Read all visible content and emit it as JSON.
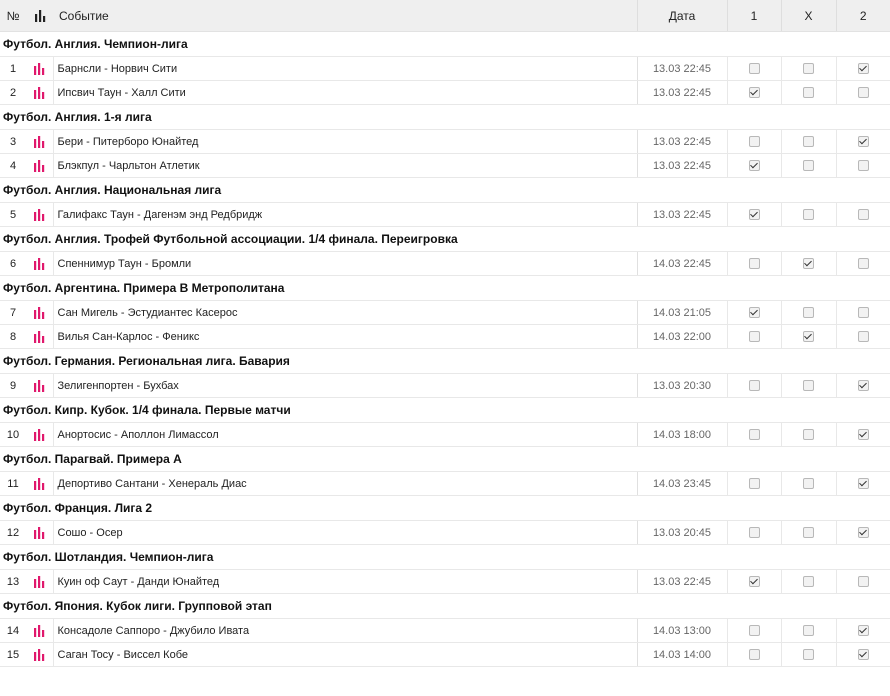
{
  "header": {
    "num": "№",
    "event": "Событие",
    "date": "Дата",
    "o1": "1",
    "ox": "X",
    "o2": "2"
  },
  "colors": {
    "accent": "#e0186c",
    "icon_dark": "#222222"
  },
  "icons": {
    "header": "bar-chart-icon",
    "row": "bar-chart-icon"
  },
  "groups": [
    {
      "title": "Футбол. Англия. Чемпион-лига",
      "events": [
        {
          "n": "1",
          "name": "Барнсли - Норвич Сити",
          "date": "13.03 22:45",
          "sel": [
            false,
            false,
            true
          ]
        },
        {
          "n": "2",
          "name": "Ипсвич Таун - Халл Сити",
          "date": "13.03 22:45",
          "sel": [
            true,
            false,
            false
          ]
        }
      ]
    },
    {
      "title": "Футбол. Англия. 1-я лига",
      "events": [
        {
          "n": "3",
          "name": "Бери - Питерборо Юнайтед",
          "date": "13.03 22:45",
          "sel": [
            false,
            false,
            true
          ]
        },
        {
          "n": "4",
          "name": "Блэкпул - Чарльтон Атлетик",
          "date": "13.03 22:45",
          "sel": [
            true,
            false,
            false
          ]
        }
      ]
    },
    {
      "title": "Футбол. Англия. Национальная лига",
      "events": [
        {
          "n": "5",
          "name": "Галифакс Таун - Дагенэм энд Редбридж",
          "date": "13.03 22:45",
          "sel": [
            true,
            false,
            false
          ]
        }
      ]
    },
    {
      "title": "Футбол. Англия. Трофей Футбольной ассоциации. 1/4 финала. Переигровка",
      "events": [
        {
          "n": "6",
          "name": "Спеннимур Таун - Бромли",
          "date": "14.03 22:45",
          "sel": [
            false,
            true,
            false
          ]
        }
      ]
    },
    {
      "title": "Футбол. Аргентина. Примера B Метрополитана",
      "events": [
        {
          "n": "7",
          "name": "Сан Мигель - Эстудиантес Касерос",
          "date": "14.03 21:05",
          "sel": [
            true,
            false,
            false
          ]
        },
        {
          "n": "8",
          "name": "Вилья Сан-Карлос - Феникс",
          "date": "14.03 22:00",
          "sel": [
            false,
            true,
            false
          ]
        }
      ]
    },
    {
      "title": "Футбол. Германия. Региональная лига. Бавария",
      "events": [
        {
          "n": "9",
          "name": "Зелигенпортен - Бухбах",
          "date": "13.03 20:30",
          "sel": [
            false,
            false,
            true
          ]
        }
      ]
    },
    {
      "title": "Футбол. Кипр. Кубок. 1/4 финала. Первые матчи",
      "events": [
        {
          "n": "10",
          "name": "Анортосис - Аполлон Лимассол",
          "date": "14.03 18:00",
          "sel": [
            false,
            false,
            true
          ]
        }
      ]
    },
    {
      "title": "Футбол. Парагвай. Примера А",
      "events": [
        {
          "n": "11",
          "name": "Депортиво Сантани - Хенераль Диас",
          "date": "14.03 23:45",
          "sel": [
            false,
            false,
            true
          ]
        }
      ]
    },
    {
      "title": "Футбол. Франция. Лига 2",
      "events": [
        {
          "n": "12",
          "name": "Сошо - Осер",
          "date": "13.03 20:45",
          "sel": [
            false,
            false,
            true
          ]
        }
      ]
    },
    {
      "title": "Футбол. Шотландия. Чемпион-лига",
      "events": [
        {
          "n": "13",
          "name": "Куин оф Саут - Данди Юнайтед",
          "date": "13.03 22:45",
          "sel": [
            true,
            false,
            false
          ]
        }
      ]
    },
    {
      "title": "Футбол. Япония. Кубок лиги. Групповой этап",
      "events": [
        {
          "n": "14",
          "name": "Консадоле Саппоро - Джубило Ивата",
          "date": "14.03 13:00",
          "sel": [
            false,
            false,
            true
          ]
        },
        {
          "n": "15",
          "name": "Саган Тосу - Виссел Кобе",
          "date": "14.03 14:00",
          "sel": [
            false,
            false,
            true
          ]
        }
      ]
    }
  ]
}
